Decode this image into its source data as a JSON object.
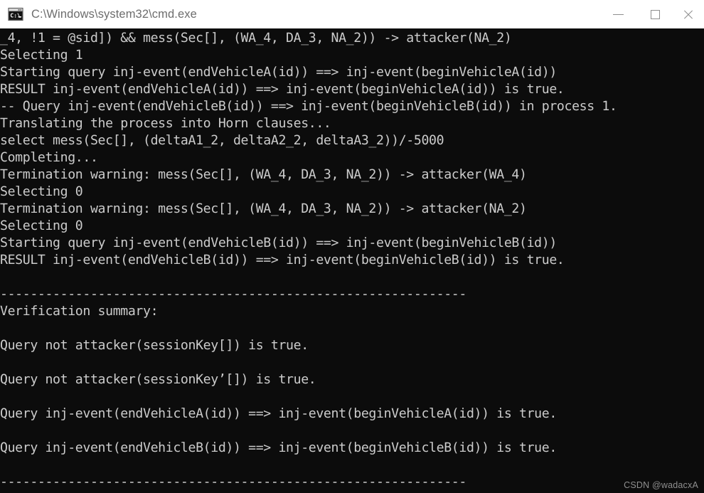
{
  "window": {
    "title": "C:\\Windows\\system32\\cmd.exe",
    "icon": "cmd-console-icon",
    "titlebar_bg": "#ffffff",
    "title_color": "#6d6d6d",
    "controls": {
      "minimize_label": "—",
      "maximize_label": "□",
      "close_label": "✕"
    }
  },
  "console": {
    "bg_color": "#0c0c0c",
    "fg_color": "#cccccc",
    "lines": [
      "_4, !1 = @sid]) && mess(Sec[], (WA_4, DA_3, NA_2)) -> attacker(NA_2)",
      "Selecting 1",
      "Starting query inj-event(endVehicleA(id)) ==> inj-event(beginVehicleA(id))",
      "RESULT inj-event(endVehicleA(id)) ==> inj-event(beginVehicleA(id)) is true.",
      "-- Query inj-event(endVehicleB(id)) ==> inj-event(beginVehicleB(id)) in process 1.",
      "Translating the process into Horn clauses...",
      "select mess(Sec[], (deltaA1_2, deltaA2_2, deltaA3_2))/-5000",
      "Completing...",
      "Termination warning: mess(Sec[], (WA_4, DA_3, NA_2)) -> attacker(WA_4)",
      "Selecting 0",
      "Termination warning: mess(Sec[], (WA_4, DA_3, NA_2)) -> attacker(NA_2)",
      "Selecting 0",
      "Starting query inj-event(endVehicleB(id)) ==> inj-event(beginVehicleB(id))",
      "RESULT inj-event(endVehicleB(id)) ==> inj-event(beginVehicleB(id)) is true.",
      "",
      "--------------------------------------------------------------",
      "Verification summary:",
      "",
      "Query not attacker(sessionKey[]) is true.",
      "",
      "Query not attacker(sessionKey’[]) is true.",
      "",
      "Query inj-event(endVehicleA(id)) ==> inj-event(beginVehicleA(id)) is true.",
      "",
      "Query inj-event(endVehicleB(id)) ==> inj-event(beginVehicleB(id)) is true.",
      "",
      "--------------------------------------------------------------"
    ]
  },
  "watermark": {
    "text": "CSDN @wadacxA"
  }
}
